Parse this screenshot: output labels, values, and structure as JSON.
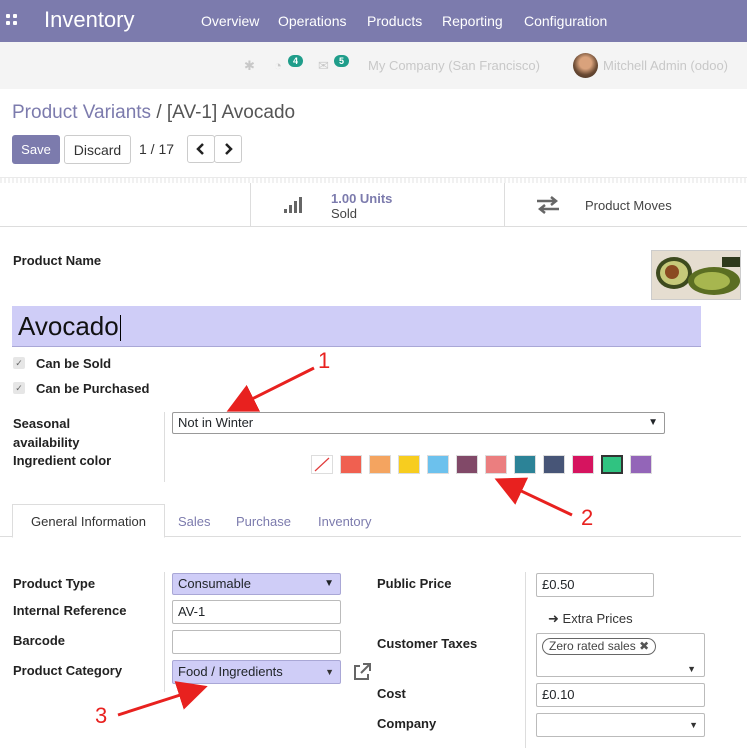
{
  "nav": {
    "app_title": "Inventory",
    "menu": [
      "Overview",
      "Operations",
      "Products",
      "Reporting",
      "Configuration"
    ]
  },
  "systray": {
    "activity_count": "4",
    "message_count": "5",
    "company": "My Company (San Francisco)",
    "user": "Mitchell Admin (odoo)"
  },
  "breadcrumb": {
    "parent": "Product Variants",
    "separator": "/",
    "current": "[AV-1] Avocado"
  },
  "controls": {
    "save": "Save",
    "discard": "Discard",
    "pager": "1 / 17",
    "prev_icon": "chevron-left-icon",
    "next_icon": "chevron-right-icon"
  },
  "stat_buttons": {
    "sold_value": "1.00 Units",
    "sold_label": "Sold",
    "moves_label": "Product Moves"
  },
  "form": {
    "product_name_label": "Product Name",
    "product_name": "Avocado",
    "can_be_sold": "Can be Sold",
    "can_be_purchased": "Can be Purchased",
    "seasonal_label": "Seasonal availability",
    "seasonal_value": "Not in Winter",
    "ingredient_color_label": "Ingredient color"
  },
  "colors": [
    "#ffffff",
    "#f06050",
    "#f4a460",
    "#f7cd1f",
    "#6cc1ed",
    "#814968",
    "#eb7e7f",
    "#2c8397",
    "#475577",
    "#d6145f",
    "#30c381",
    "#9365b8"
  ],
  "tabs": [
    "General Information",
    "Sales",
    "Purchase",
    "Inventory"
  ],
  "general": {
    "product_type_label": "Product Type",
    "product_type": "Consumable",
    "internal_ref_label": "Internal Reference",
    "internal_ref": "AV-1",
    "barcode_label": "Barcode",
    "barcode": "",
    "category_label": "Product Category",
    "category": "Food / Ingredients",
    "public_price_label": "Public Price",
    "public_price": "£0.50",
    "extra_prices": "Extra Prices",
    "customer_taxes_label": "Customer Taxes",
    "customer_tax_tag": "Zero rated sales",
    "cost_label": "Cost",
    "cost": "£0.10",
    "company_label": "Company",
    "company": ""
  },
  "annotations": [
    "1",
    "2",
    "3"
  ]
}
